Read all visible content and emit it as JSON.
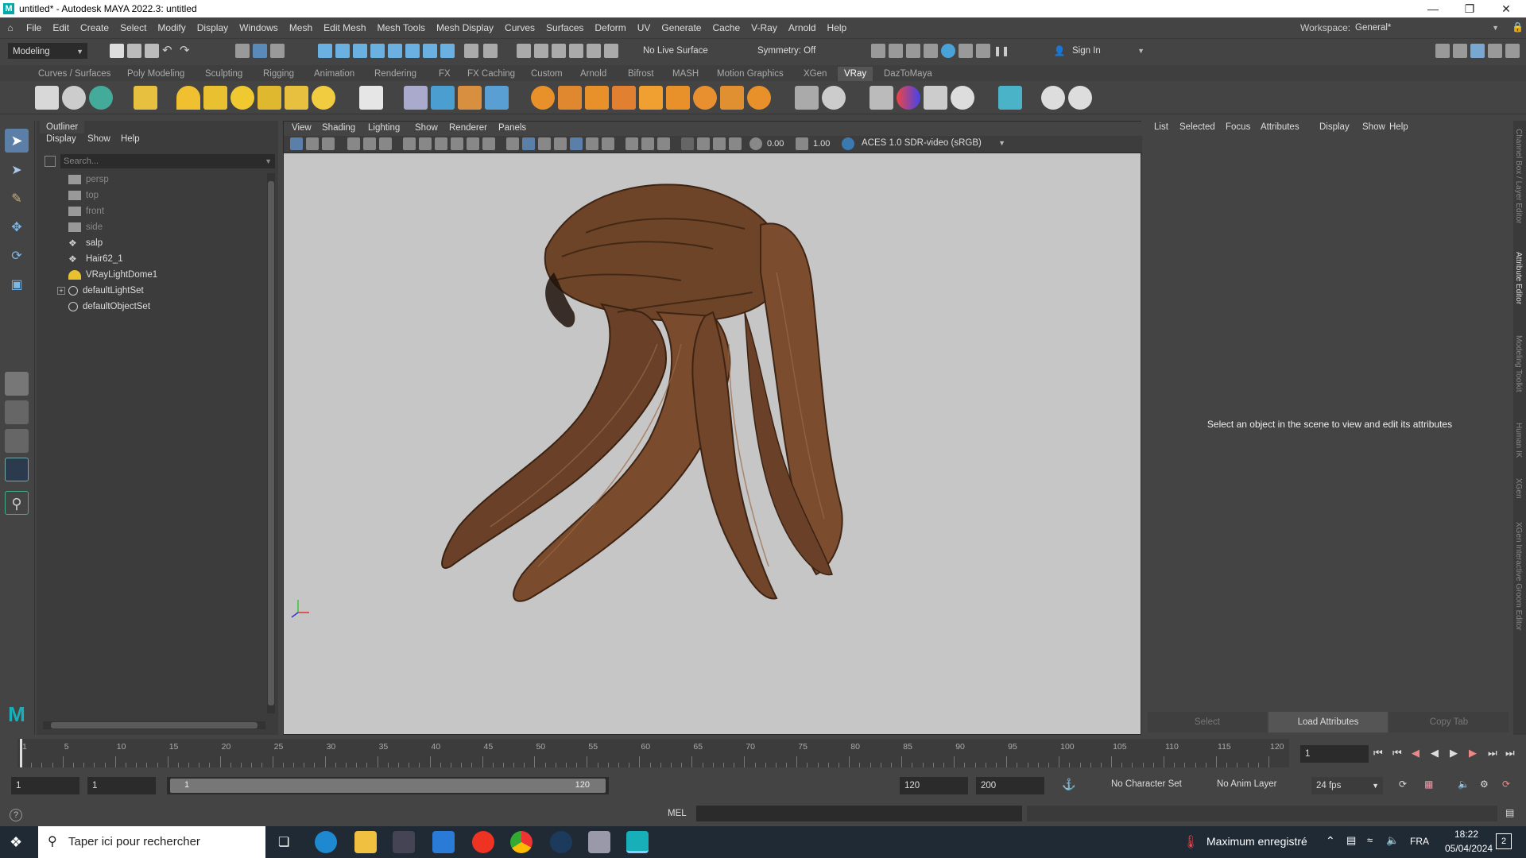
{
  "window": {
    "title": "untitled* - Autodesk MAYA 2022.3: untitled"
  },
  "menubar": {
    "items": [
      "File",
      "Edit",
      "Create",
      "Select",
      "Modify",
      "Display",
      "Windows",
      "Mesh",
      "Edit Mesh",
      "Mesh Tools",
      "Mesh Display",
      "Curves",
      "Surfaces",
      "Deform",
      "UV",
      "Generate",
      "Cache",
      "V-Ray",
      "Arnold",
      "Help"
    ],
    "workspace_label": "Workspace:",
    "workspace_value": "General*"
  },
  "statusline": {
    "mode": "Modeling",
    "live_surface": "No Live Surface",
    "symmetry": "Symmetry: Off",
    "sign_in": "Sign In"
  },
  "shelf": {
    "tabs": [
      "Curves / Surfaces",
      "Poly Modeling",
      "Sculpting",
      "Rigging",
      "Animation",
      "Rendering",
      "FX",
      "FX Caching",
      "Custom",
      "Arnold",
      "Bifrost",
      "MASH",
      "Motion Graphics",
      "XGen",
      "VRay",
      "DazToMaya"
    ],
    "active_tab": "VRay"
  },
  "outliner": {
    "tab": "Outliner",
    "menu": [
      "Display",
      "Show",
      "Help"
    ],
    "search_placeholder": "Search...",
    "items": [
      {
        "label": "persp",
        "icon": "camera-icon",
        "dim": true
      },
      {
        "label": "top",
        "icon": "camera-icon",
        "dim": true
      },
      {
        "label": "front",
        "icon": "camera-icon",
        "dim": true
      },
      {
        "label": "side",
        "icon": "camera-icon",
        "dim": true
      },
      {
        "label": "salp",
        "icon": "transform-icon",
        "dim": false
      },
      {
        "label": "Hair62_1",
        "icon": "transform-icon",
        "dim": false
      },
      {
        "label": "VRayLightDome1",
        "icon": "dome-light-icon",
        "dim": false
      },
      {
        "label": "defaultLightSet",
        "icon": "set-icon",
        "dim": false,
        "expandable": true
      },
      {
        "label": "defaultObjectSet",
        "icon": "set-icon",
        "dim": false
      }
    ]
  },
  "viewport": {
    "menu": [
      "View",
      "Shading",
      "Lighting",
      "Show",
      "Renderer",
      "Panels"
    ],
    "exposure": "0.00",
    "gamma": "1.00",
    "color_space": "ACES 1.0 SDR-video (sRGB)"
  },
  "attribute_editor": {
    "menu": [
      "List",
      "Selected",
      "Focus",
      "Attributes",
      "Display",
      "Show",
      "Help"
    ],
    "message": "Select an object in the scene to view and edit its attributes",
    "buttons": {
      "select": "Select",
      "load": "Load Attributes",
      "copy": "Copy Tab"
    }
  },
  "side_tabs": [
    "Channel Box / Layer Editor",
    "Attribute Editor",
    "Modeling Toolkit",
    "Human IK",
    "XGen",
    "XGen Interactive Groom Editor"
  ],
  "timeline": {
    "ticks": [
      "1",
      "5",
      "10",
      "15",
      "20",
      "25",
      "30",
      "35",
      "40",
      "45",
      "50",
      "55",
      "60",
      "65",
      "70",
      "75",
      "80",
      "85",
      "90",
      "95",
      "100",
      "105",
      "110",
      "115",
      "120"
    ],
    "current_frame": "1"
  },
  "range": {
    "start": "1",
    "inner_start": "1",
    "slider_start": "1",
    "slider_end": "120",
    "end": "120",
    "anim_end": "200",
    "character_set": "No Character Set",
    "anim_layer": "No Anim Layer",
    "fps": "24 fps"
  },
  "cmdline": {
    "lang": "MEL"
  },
  "taskbar": {
    "search": "Taper ici pour rechercher",
    "weather": "Maximum enregistré",
    "lang": "FRA",
    "time": "18:22",
    "date": "05/04/2024",
    "notif_count": "2"
  }
}
